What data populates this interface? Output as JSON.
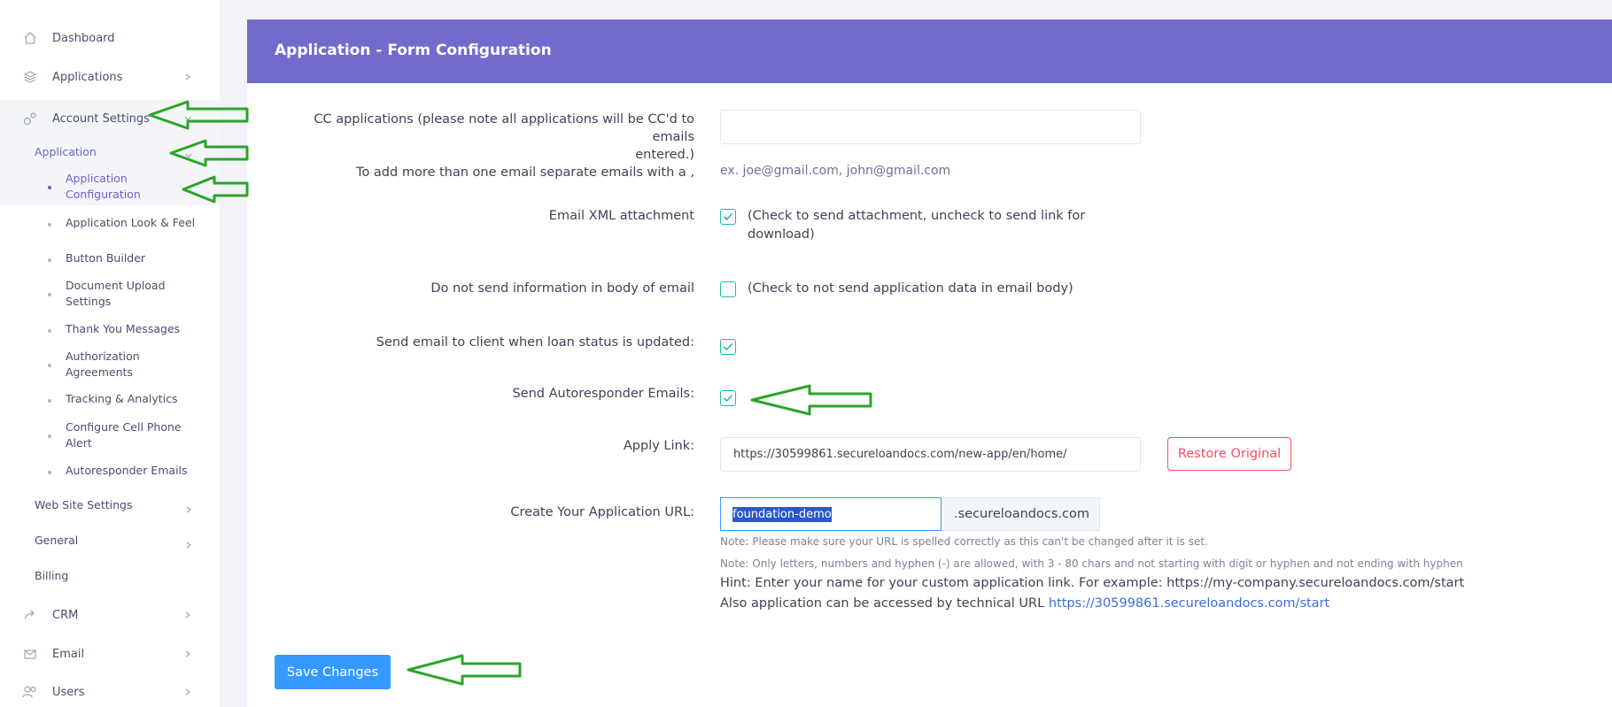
{
  "sidebar": {
    "items": [
      {
        "label": "Dashboard",
        "icon": "home-icon"
      },
      {
        "label": "Applications",
        "icon": "layers-icon"
      },
      {
        "label": "Account Settings",
        "icon": "gears-icon"
      }
    ],
    "account_sub": {
      "application_label": "Application",
      "application_children": [
        {
          "label": "Application Configuration"
        },
        {
          "label": "Application Look & Feel"
        },
        {
          "label": "Button Builder"
        },
        {
          "label": "Document Upload Settings"
        },
        {
          "label": "Thank You Messages"
        },
        {
          "label": "Authorization Agreements"
        },
        {
          "label": "Tracking & Analytics"
        },
        {
          "label": "Configure Cell Phone Alert"
        },
        {
          "label": "Autoresponder Emails"
        }
      ],
      "website_settings_label": "Web Site Settings",
      "general_label": "General",
      "billing_label": "Billing"
    },
    "bottom_items": [
      {
        "label": "CRM",
        "icon": "share-icon"
      },
      {
        "label": "Email",
        "icon": "mail-icon"
      },
      {
        "label": "Users",
        "icon": "users-icon"
      }
    ]
  },
  "card": {
    "title": "Application - Form Configuration"
  },
  "form": {
    "cc_label_line1": "CC applications (please note all applications will be CC'd to emails",
    "cc_label_line2": "entered.)",
    "cc_label_line3": "To add more than one email separate emails with a ,",
    "cc_value": "",
    "cc_hint": "ex. joe@gmail.com, john@gmail.com",
    "xml_label": "Email XML attachment",
    "xml_checked": true,
    "xml_text_line1": "(Check to send attachment, uncheck to send link for",
    "xml_text_line2": "download)",
    "no_body_label": "Do not send information in body of email",
    "no_body_checked": false,
    "no_body_text": "(Check to not send application data in email body)",
    "status_label": "Send email to client when loan status is updated:",
    "status_checked": true,
    "autoresponder_label": "Send Autoresponder Emails:",
    "autoresponder_checked": true,
    "apply_link_label": "Apply Link:",
    "apply_link_value": "https://30599861.secureloandocs.com/new-app/en/home/",
    "restore_label": "Restore Original",
    "url_label": "Create Your Application URL:",
    "url_value": "foundation-demo",
    "url_suffix": ".secureloandocs.com",
    "note1": "Note: Please make sure your URL is spelled correctly as this can't be changed after it is set.",
    "note2": "Note: Only letters, numbers and hyphen (-) are allowed, with 3 - 80 chars and not starting with digit or hyphen and not ending with hyphen",
    "hint1": "Hint: Enter your name for your custom application link. For example: https://my-company.secureloandocs.com/start",
    "hint2_prefix": "Also application can be accessed by technical URL",
    "hint2_link": "https://30599861.secureloandocs.com/start",
    "save_label": "Save Changes"
  },
  "colors": {
    "header": "#736bcb",
    "accent": "#6c63c9",
    "checkbox": "#20b8a8",
    "primary_button": "#3699ff",
    "danger": "#f64e60",
    "annotation_arrow": "#2aa52a"
  }
}
